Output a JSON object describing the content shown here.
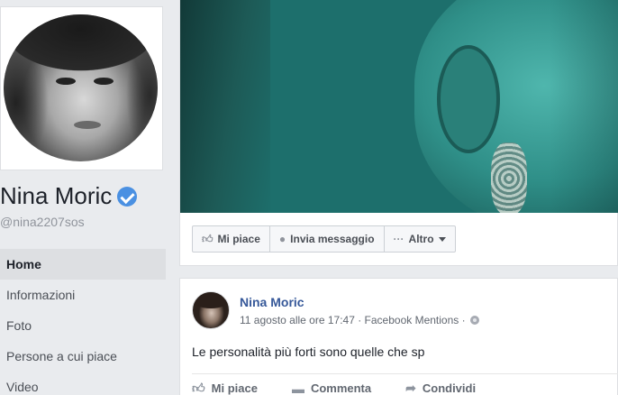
{
  "profile": {
    "name": "Nina Moric",
    "handle": "@nina2207sos"
  },
  "nav": {
    "items": [
      {
        "label": "Home"
      },
      {
        "label": "Informazioni"
      },
      {
        "label": "Foto"
      },
      {
        "label": "Persone a cui piace"
      },
      {
        "label": "Video"
      }
    ]
  },
  "actions": {
    "like": "Mi piace",
    "message": "Invia messaggio",
    "more": "Altro"
  },
  "post": {
    "author": "Nina Moric",
    "meta": "11 agosto alle ore 17:47 · Facebook Mentions ·",
    "text": "Le personalità più forti sono quelle che sp",
    "like": "Mi piace",
    "comment": "Commenta",
    "share": "Condividi"
  },
  "colors": {
    "link": "#365899",
    "verified": "#4a90e2",
    "background": "#e9ebee"
  }
}
